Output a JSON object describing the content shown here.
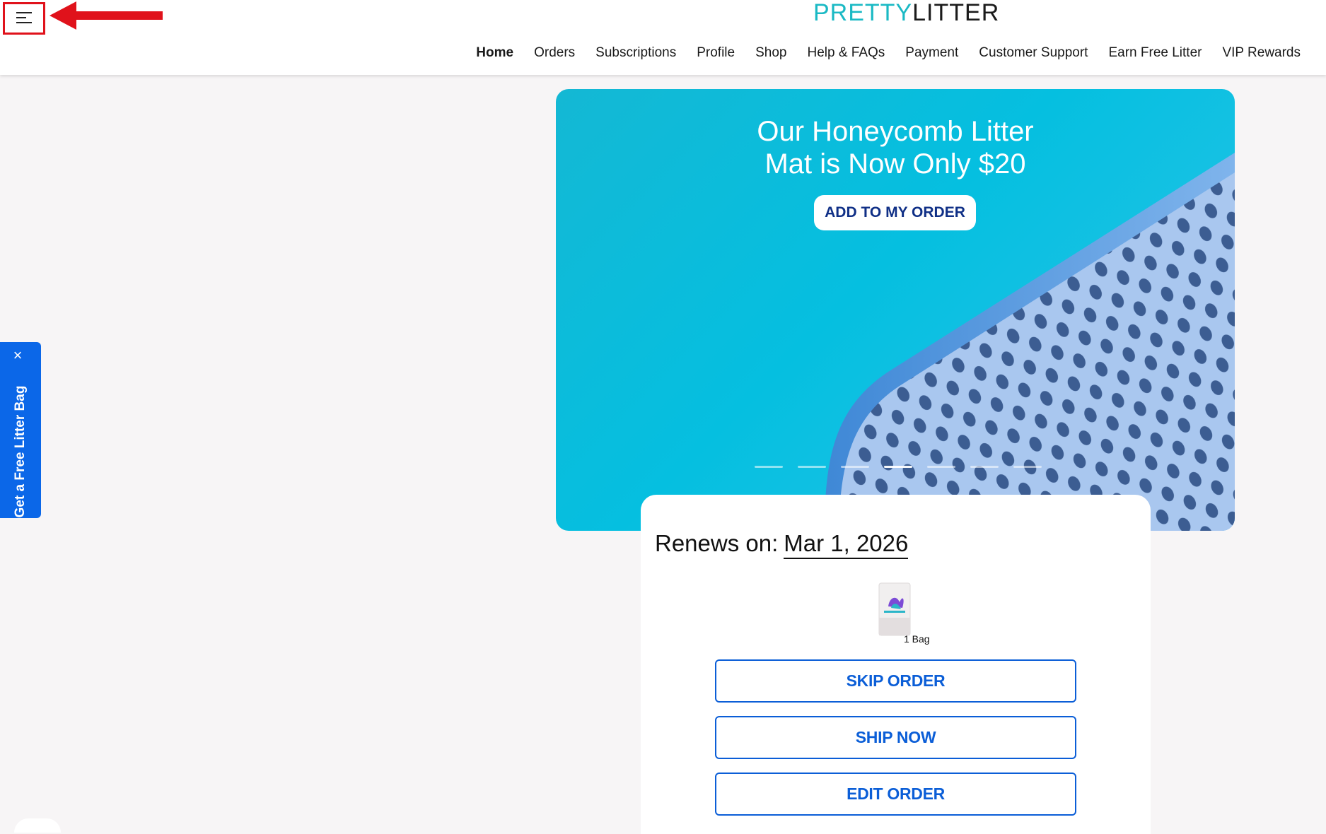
{
  "header": {
    "logo_left": "PRETTY",
    "logo_right": "LITTER",
    "menu_icon": "hamburger-menu-icon",
    "nav": [
      {
        "label": "Home",
        "active": true
      },
      {
        "label": "Orders"
      },
      {
        "label": "Subscriptions"
      },
      {
        "label": "Profile"
      },
      {
        "label": "Shop"
      },
      {
        "label": "Help & FAQs"
      },
      {
        "label": "Payment"
      },
      {
        "label": "Customer Support"
      },
      {
        "label": "Earn Free Litter"
      },
      {
        "label": "VIP Rewards"
      }
    ]
  },
  "side_tab": {
    "label": "Get a Free Litter Bag",
    "close_icon": "close-icon"
  },
  "banner": {
    "headline_line1": "Our Honeycomb Litter",
    "headline_line2": "Mat is Now Only $20",
    "cta": "ADD TO MY ORDER",
    "slide_count": 7,
    "active_slide": 4
  },
  "renewal": {
    "label": "Renews on:",
    "date": "Mar 1, 2026",
    "product_qty": "1 Bag",
    "skip_label": "SKIP ORDER",
    "ship_label": "SHIP NOW",
    "edit_label": "EDIT ORDER"
  },
  "colors": {
    "accent_blue": "#0b5ed7",
    "brand_teal": "#1ab9c4",
    "side_tab_blue": "#0b67e8",
    "annotation_red": "#e0121b",
    "cta_text": "#0f2f86"
  }
}
